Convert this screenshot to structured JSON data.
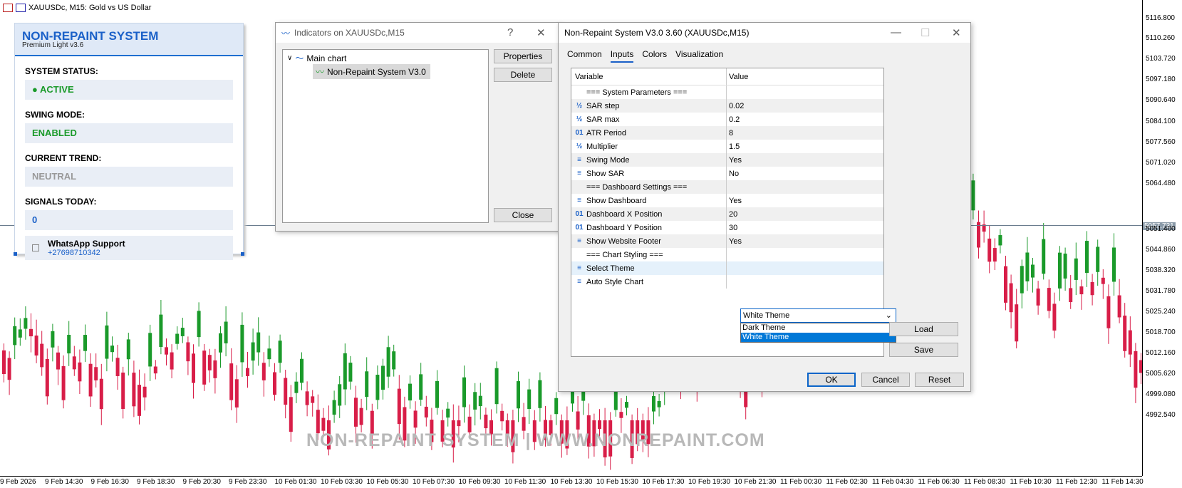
{
  "chart": {
    "title": "XAUUSDc, M15:  Gold vs US Dollar",
    "prices": [
      "5116.800",
      "5110.260",
      "5103.720",
      "5097.180",
      "5090.640",
      "5084.100",
      "5077.560",
      "5071.020",
      "5064.480",
      "5057.731",
      "5051.400",
      "5044.860",
      "5038.320",
      "5031.780",
      "5025.240",
      "5018.700",
      "5012.160",
      "5005.620",
      "4999.080",
      "4992.540"
    ],
    "current_price": "5057.731",
    "times": [
      "9 Feb 2026",
      "9 Feb 14:30",
      "9 Feb 16:30",
      "9 Feb 18:30",
      "9 Feb 20:30",
      "9 Feb 23:30",
      "10 Feb 01:30",
      "10 Feb 03:30",
      "10 Feb 05:30",
      "10 Feb 07:30",
      "10 Feb 09:30",
      "10 Feb 11:30",
      "10 Feb 13:30",
      "10 Feb 15:30",
      "10 Feb 17:30",
      "10 Feb 19:30",
      "10 Feb 21:30",
      "11 Feb 00:30",
      "11 Feb 02:30",
      "11 Feb 04:30",
      "11 Feb 06:30",
      "11 Feb 08:30",
      "11 Feb 10:30",
      "11 Feb 12:30",
      "11 Feb 14:30"
    ],
    "watermark": "NON-REPAINT SYSTEM | WWW.NONREPAINT.COM",
    "bull_color": "#1a9a2a",
    "bear_color": "#d81e48"
  },
  "dashboard": {
    "title": "NON-REPAINT SYSTEM",
    "subtitle": "Premium Light v3.6",
    "status_label": "SYSTEM STATUS:",
    "status_value": "● ACTIVE",
    "swing_label": "SWING MODE:",
    "swing_value": "ENABLED",
    "trend_label": "CURRENT TREND:",
    "trend_value": "NEUTRAL",
    "signals_label": "SIGNALS TODAY:",
    "signals_value": "0",
    "support_title": "WhatsApp Support",
    "support_phone": "+27698710342"
  },
  "indicators_dialog": {
    "title": "Indicators on XAUUSDc,M15",
    "help": "?",
    "close_x": "✕",
    "tree_root": "Main chart",
    "tree_item": "Non-Repaint System V3.0",
    "properties": "Properties",
    "delete": "Delete",
    "close": "Close"
  },
  "props_dialog": {
    "title": "Non-Repaint System V3.0 3.60 (XAUUSDc,M15)",
    "tabs": [
      "Common",
      "Inputs",
      "Colors",
      "Visualization"
    ],
    "active_tab": "Inputs",
    "col_variable": "Variable",
    "col_value": "Value",
    "rows": [
      {
        "icon": "",
        "name": "=== System Parameters ===",
        "value": ""
      },
      {
        "icon": "½",
        "name": "SAR step",
        "value": "0.02"
      },
      {
        "icon": "½",
        "name": "SAR max",
        "value": "0.2"
      },
      {
        "icon": "01",
        "name": "ATR Period",
        "value": "8"
      },
      {
        "icon": "½",
        "name": "Multiplier",
        "value": "1.5"
      },
      {
        "icon": "≡",
        "name": "Swing Mode",
        "value": "Yes"
      },
      {
        "icon": "≡",
        "name": "Show SAR",
        "value": "No"
      },
      {
        "icon": "",
        "name": "=== Dashboard Settings ===",
        "value": ""
      },
      {
        "icon": "≡",
        "name": "Show Dashboard",
        "value": "Yes"
      },
      {
        "icon": "01",
        "name": "Dashboard X Position",
        "value": "20"
      },
      {
        "icon": "01",
        "name": "Dashboard Y Position",
        "value": "30"
      },
      {
        "icon": "≡",
        "name": "Show Website Footer",
        "value": "Yes"
      },
      {
        "icon": "",
        "name": "=== Chart Styling ===",
        "value": ""
      },
      {
        "icon": "≡",
        "name": "Select Theme",
        "value": ""
      },
      {
        "icon": "≡",
        "name": "Auto Style Chart",
        "value": ""
      }
    ],
    "select_value": "White Theme",
    "dropdown_options": [
      "Dark Theme",
      "White Theme"
    ],
    "dropdown_selected": "White Theme",
    "load": "Load",
    "save": "Save",
    "ok": "OK",
    "cancel": "Cancel",
    "reset": "Reset"
  }
}
